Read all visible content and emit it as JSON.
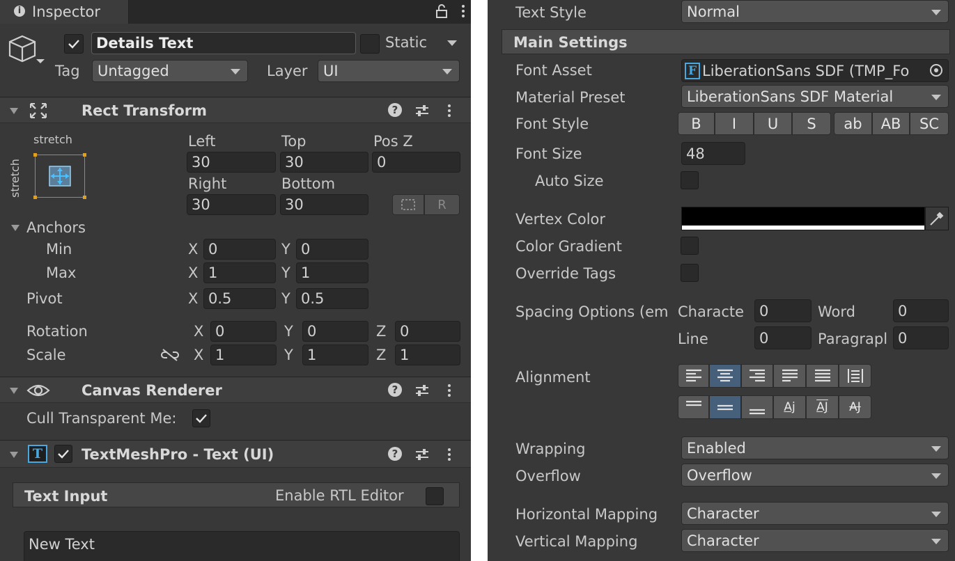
{
  "inspector": {
    "tab_title": "Inspector",
    "object": {
      "name": "Details Text",
      "static_label": "Static",
      "tag_label": "Tag",
      "tag_value": "Untagged",
      "layer_label": "Layer",
      "layer_value": "UI"
    },
    "rect_transform": {
      "title": "Rect Transform",
      "anchor_preset_h": "stretch",
      "anchor_preset_v": "stretch",
      "labels": {
        "left": "Left",
        "top": "Top",
        "posz": "Pos Z",
        "right": "Right",
        "bottom": "Bottom"
      },
      "values": {
        "left": "30",
        "top": "30",
        "posz": "0",
        "right": "30",
        "bottom": "30"
      },
      "raw_button": "R",
      "anchors_label": "Anchors",
      "min_label": "Min",
      "max_label": "Max",
      "pivot_label": "Pivot",
      "rotation_label": "Rotation",
      "scale_label": "Scale",
      "axis_x": "X",
      "axis_y": "Y",
      "axis_z": "Z",
      "min": {
        "x": "0",
        "y": "0"
      },
      "max": {
        "x": "1",
        "y": "1"
      },
      "pivot": {
        "x": "0.5",
        "y": "0.5"
      },
      "rotation": {
        "x": "0",
        "y": "0",
        "z": "0"
      },
      "scale": {
        "x": "1",
        "y": "1",
        "z": "1"
      }
    },
    "canvas_renderer": {
      "title": "Canvas Renderer",
      "cull_label": "Cull Transparent Me:"
    },
    "tmp": {
      "title": "TextMeshPro - Text (UI)",
      "text_input_label": "Text Input",
      "rtl_label": "Enable RTL Editor",
      "text_value": "New Text",
      "icon_letter": "T"
    }
  },
  "tmp_settings": {
    "text_style_label": "Text Style",
    "text_style_value": "Normal",
    "main_settings": "Main Settings",
    "font_asset_label": "Font Asset",
    "font_asset_value": "LiberationSans SDF (TMP_Fo",
    "font_asset_icon": "F",
    "material_preset_label": "Material Preset",
    "material_preset_value": "LiberationSans SDF Material",
    "font_style_label": "Font Style",
    "font_style_buttons": [
      "B",
      "I",
      "U",
      "S",
      "ab",
      "AB",
      "SC"
    ],
    "font_size_label": "Font Size",
    "font_size_value": "48",
    "auto_size_label": "Auto Size",
    "vertex_color_label": "Vertex Color",
    "vertex_color": "#000000",
    "color_gradient_label": "Color Gradient",
    "override_tags_label": "Override Tags",
    "spacing_label": "Spacing Options (em",
    "character_label": "Characte",
    "character_value": "0",
    "word_label": "Word",
    "word_value": "0",
    "line_label": "Line",
    "line_value": "0",
    "paragraph_label": "Paragrapl",
    "paragraph_value": "0",
    "alignment_label": "Alignment",
    "wrapping_label": "Wrapping",
    "wrapping_value": "Enabled",
    "overflow_label": "Overflow",
    "overflow_value": "Overflow",
    "hmap_label": "Horizontal Mapping",
    "hmap_value": "Character",
    "vmap_label": "Vertical Mapping",
    "vmap_value": "Character"
  },
  "colors": {
    "panel": "#383838",
    "field": "#2a2a2a",
    "selected": "#46607c",
    "accent": "#4aa8e0"
  }
}
